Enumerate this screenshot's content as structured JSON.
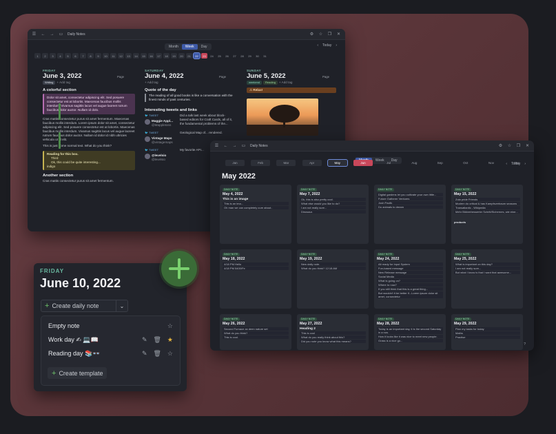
{
  "win1": {
    "title": "Daily Notes",
    "views": [
      "Month",
      "Week",
      "Day"
    ],
    "active_view": "Week",
    "today": "Today",
    "days": [
      "1",
      "2",
      "3",
      "4",
      "5",
      "6",
      "7",
      "8",
      "9",
      "10",
      "11",
      "12",
      "13",
      "14",
      "15",
      "16",
      "17",
      "18",
      "19",
      "20",
      "21",
      "22",
      "23",
      "24",
      "25",
      "26",
      "27",
      "28",
      "29",
      "30",
      "31"
    ],
    "friday": {
      "dow": "FRIDAY",
      "date": "June 3, 2022",
      "page": "Page",
      "tags": [
        "Writing"
      ],
      "add_tag": "Add tag",
      "section": "A colorful section",
      "callout": "Dolor sit amet, consectetur adipiscing elit. Sed posuere consectetur est at lobortis. Maecenas faucibus mollis interdum. Vivamus sagittis lacus vel augue laoreet rutrum faucibus dolor auctor. Nullam id dolo.",
      "para": "Cras mattis consectetur purus sit amet fermentum. Maecenas faucibus mollis interdum. Lorem ipsum dolor sit amet, consectetur adipiscing elit. Sed posuere consectetur est at lobortis. Maecenas faucibus mollis interdum. Vivamus sagittis lacus vel augue laoreet rutrum faucibus dolor auctor. Nullam id dolor id nibh ultricies vehicula ut id elit.",
      "normal": "This is just some normal text. What do you think?",
      "box_title": "Reading for this box.",
      "box_items": [
        "Third",
        "Ok, this could be quite interesting..."
      ],
      "box_end": "indigo",
      "section2": "Another section",
      "para2": "Cras mattis consectetur purus sit amet fermentum."
    },
    "saturday": {
      "dow": "SATURDAY",
      "date": "June 4, 2022",
      "page": "Page",
      "add_tag": "Add tag",
      "h": "Quote of the day",
      "quote": "The reading of all good books is like a conversation with the finest minds of past centuries.",
      "h2": "Interesting tweets and links",
      "tweets": [
        {
          "label": "TWEET",
          "name": "Maggie Appl...",
          "handle": "@Mappletons",
          "text": "Did a talk last week about block-based editors for Craft Cards, all of it, the fundamental problems of the..."
        },
        {
          "label": "TWEET",
          "name": "Vintage Maps",
          "handle": "@vintagemaps",
          "text": "Geological Map of... rendered."
        },
        {
          "label": "TWEET",
          "name": "@levelsio",
          "handle": "@levelsio",
          "text": "My favorite API..."
        }
      ]
    },
    "sunday": {
      "dow": "SUNDAY",
      "date": "June 5, 2022",
      "page": "Page",
      "tags": [
        "weekend",
        "Reading"
      ],
      "add_tag": "Add tag",
      "relax": "Relax!"
    }
  },
  "win2": {
    "title": "Daily Notes",
    "views": [
      "Month",
      "Week",
      "Day"
    ],
    "active_view": "Month",
    "today": "Today",
    "months": [
      "Jan",
      "Feb",
      "Mar",
      "Apr",
      "May",
      "Jun",
      "Jul",
      "Aug",
      "Sep",
      "Oct",
      "Nov",
      "Dec"
    ],
    "active_month": "May",
    "heading": "May 2022",
    "badge": "DAILY NOTE",
    "cells": [
      {
        "date": "May 4, 2022",
        "title": "This is an image",
        "lines": [
          "This is an ima...",
          "Oh man we can completely cure about.."
        ]
      },
      {
        "date": "May 7, 2022",
        "lines": [
          "Ok, this is also pretty cool.",
          "What else would you like to do?",
          "I am not really sure...",
          "Dinosaur."
        ]
      },
      {
        "date": "",
        "lines": [
          "Digital gardens let you cultivate your own little...",
          "Future Gatherer Ventures",
          "Josh Pavlik",
          "Do animals to dream"
        ]
      },
      {
        "date": "May 15, 2022",
        "lines": [
          "Zola pride Friends",
          "Modern do critical & has Kampfsverbaum seasons",
          "Transatlantic - Wikipedia",
          "Mehr Bildverbesserter Schritt/Sichernes, wie eine..."
        ],
        "tag": "products"
      },
      {
        "date": "May 18, 2022",
        "lines": [
          "4/18 PM Hello",
          "4/18 PM 5400/Fe"
        ]
      },
      {
        "date": "May 19, 2022",
        "lines": [
          "New daily note.",
          "What do you think? 12:18 AM"
        ]
      },
      {
        "date": "May 24, 2022",
        "lines": [
          "All ready for Input System",
          "Fun-based message",
          "New Release message",
          "Social Media",
          "What is going on?",
          "Where to now?",
          "If you still think that this is a great thing...",
          "But wouldn't it be better if...Lorem ipsum dolor sit amet, consectetur"
        ]
      },
      {
        "date": "May 25, 2022",
        "lines": [
          "What is important on this day?",
          "I am not really sure...",
          "But what I know is that I want that awesome..."
        ]
      },
      {
        "date": "May 26, 2022",
        "lines": [
          "Second Furnace ax deen nature set",
          "What do you think?",
          "This is cool."
        ]
      },
      {
        "date": "May 27, 2022",
        "title": "Heading 2",
        "lines": [
          "This is cool",
          "What do you really think about this?",
          "Did you note you know what this means?"
        ]
      },
      {
        "date": "May 28, 2022",
        "lines": [
          "Today is an important day, it is the second Saturday in a row.",
          "How it looks like it was nice to meet new people.",
          "Grass is a nice go..."
        ]
      },
      {
        "date": "May 29, 2022",
        "lines": [
          "Plan my tasks for today",
          "Maths",
          "Practise"
        ]
      }
    ]
  },
  "daily": {
    "dow": "FRIDAY",
    "date": "June 10, 2022",
    "create": "Create daily note",
    "templates": [
      {
        "name": "Empty note",
        "starred": false
      },
      {
        "name": "Work day ✍ 💻📖",
        "starred": true
      },
      {
        "name": "Reading day 📚👓",
        "starred": false
      }
    ],
    "create_template": "Create template"
  }
}
